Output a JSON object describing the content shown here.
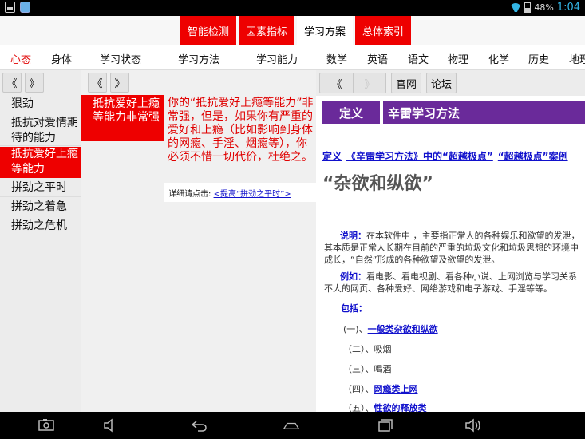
{
  "status": {
    "battery": "48%",
    "time": "1:04"
  },
  "main_tabs": [
    {
      "label": "智能检测",
      "active": false
    },
    {
      "label": "因素指标",
      "active": false
    },
    {
      "label": "学习方案",
      "active": true
    },
    {
      "label": "总体索引",
      "active": false
    }
  ],
  "sub_nav": [
    "心态",
    "身体",
    "学习状态",
    "学习方法",
    "学习能力",
    "数学",
    "英语",
    "语文",
    "物理",
    "化学",
    "历史",
    "地理"
  ],
  "nav": {
    "prev": "《",
    "next": "》"
  },
  "col1_items": [
    "狠劲",
    "抵抗对爱情期待的能力",
    "抵抗爱好上瘾等能力",
    "拼劲之平时",
    "拼劲之着急",
    "拼劲之危机"
  ],
  "col2": {
    "selected": "抵抗爱好上瘾等能力非常强",
    "description": "你的“抵抗爱好上瘾等能力”非常强，但是，如果你有严重的爱好和上瘾（比如影响到身体的网瘾、手淫、烟瘾等），你必须不惜一切代价，杜绝之。",
    "detail_prefix": "详细请点击:",
    "detail_link": "<提高“拼劲之平时”>"
  },
  "col3": {
    "btn_official": "官网",
    "btn_forum": "论坛",
    "def_label": "定义",
    "def_title": "辛雷学习方法",
    "crumbs": [
      "定义",
      "《辛雷学习方法》中的“超越极点”",
      "“超越极点”案例"
    ],
    "big_title": "“杂欲和纵欲”",
    "explain_label": "说明：",
    "explain_text": "在本软件中 ，主要指正常人的各种娱乐和欲望的发泄，其本质是正常人长期在目前的严重的垃圾文化和垃圾思想的环境中成长，“自然”形成的各种欲望及欲望的发泄。",
    "example_label": "例如：",
    "example_text": "看电影、看电视剧、看各种小说、上网浏览与学习关系不大的网页、各种爱好、网络游戏和电子游戏、手淫等等。",
    "include_label": "包括：",
    "include_items": [
      {
        "prefix": "(一)、",
        "text": "一般类杂欲和纵欲",
        "link": true
      },
      {
        "prefix": "（二）、",
        "text": "吸烟",
        "link": false
      },
      {
        "prefix": "（三）、",
        "text": "喝酒",
        "link": false
      },
      {
        "prefix": "（四）、",
        "text": "网瘾类上网",
        "link": true
      },
      {
        "prefix": "（五）、",
        "text": "性欲的释放类",
        "link": true
      }
    ]
  },
  "icons": {
    "status": [
      "image-icon",
      "bag-icon",
      "wifi-icon",
      "battery-icon"
    ],
    "navbar": [
      "screenshot-icon",
      "volume-down-icon",
      "back-icon",
      "home-icon",
      "recents-icon",
      "volume-up-icon"
    ]
  },
  "colors": {
    "accent_red": "#ee0000",
    "def_purple": "#6a2a9a",
    "link_blue": "#1111cc"
  }
}
